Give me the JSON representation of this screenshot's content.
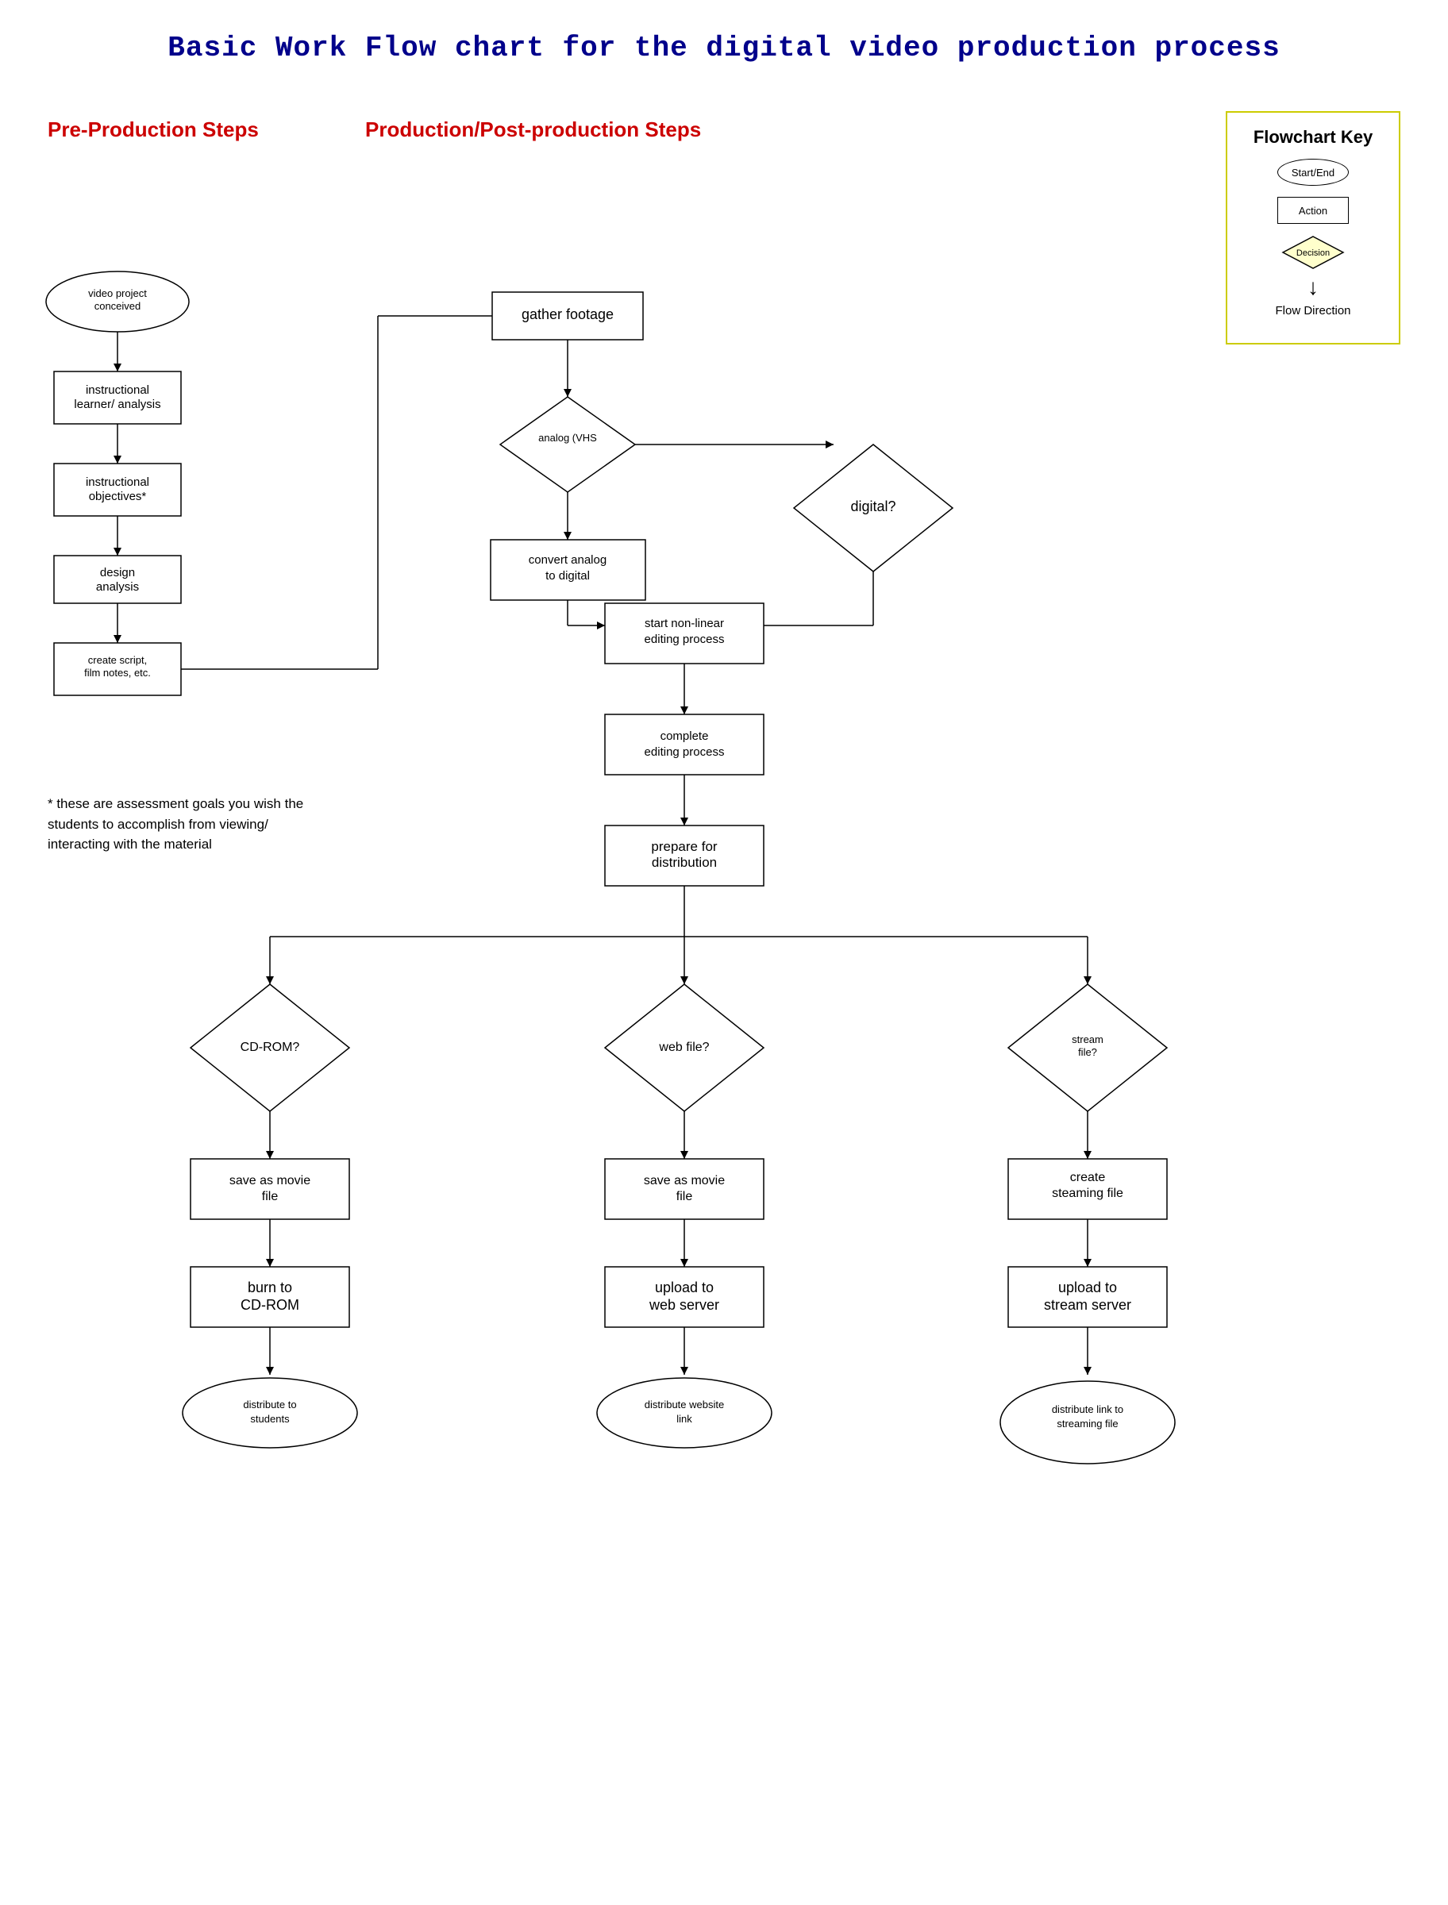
{
  "title": "Basic Work Flow chart for the digital video production process",
  "sections": {
    "pre_production": "Pre-Production Steps",
    "production": "Production/Post-production Steps"
  },
  "key": {
    "title": "Flowchart Key",
    "start_end": "Start/End",
    "action": "Action",
    "decision": "Decision",
    "flow_direction": "Flow Direction"
  },
  "nodes": {
    "video_project": "video project conceived",
    "instructional_learner": "instructional learner/ analysis",
    "instructional_objectives": "instructional objectives*",
    "design_analysis": "design analysis",
    "create_script": "create script, film notes, etc.",
    "gather_footage": "gather footage",
    "analog_vhs": "analog (VHS",
    "digital": "digital?",
    "convert_analog": "convert analog to digital",
    "start_nonlinear": "start non-linear editing process",
    "complete_editing": "complete editing process",
    "prepare_distribution": "prepare for distribution",
    "cdrom_decision": "CD-ROM?",
    "web_file_decision": "web file?",
    "stream_file_decision": "stream file?",
    "save_movie_cdrom": "save as movie file",
    "save_movie_web": "save as movie file",
    "create_streaming": "create steaming file",
    "burn_cdrom": "burn to CD-ROM",
    "upload_web": "upload to web server",
    "upload_stream": "upload to stream server",
    "distribute_students": "distribute to students",
    "distribute_website": "distribute website link",
    "distribute_link": "distribute link to streaming file"
  },
  "note": "* these are assessment goals you wish the students to accomplish from viewing/ interacting with the material"
}
